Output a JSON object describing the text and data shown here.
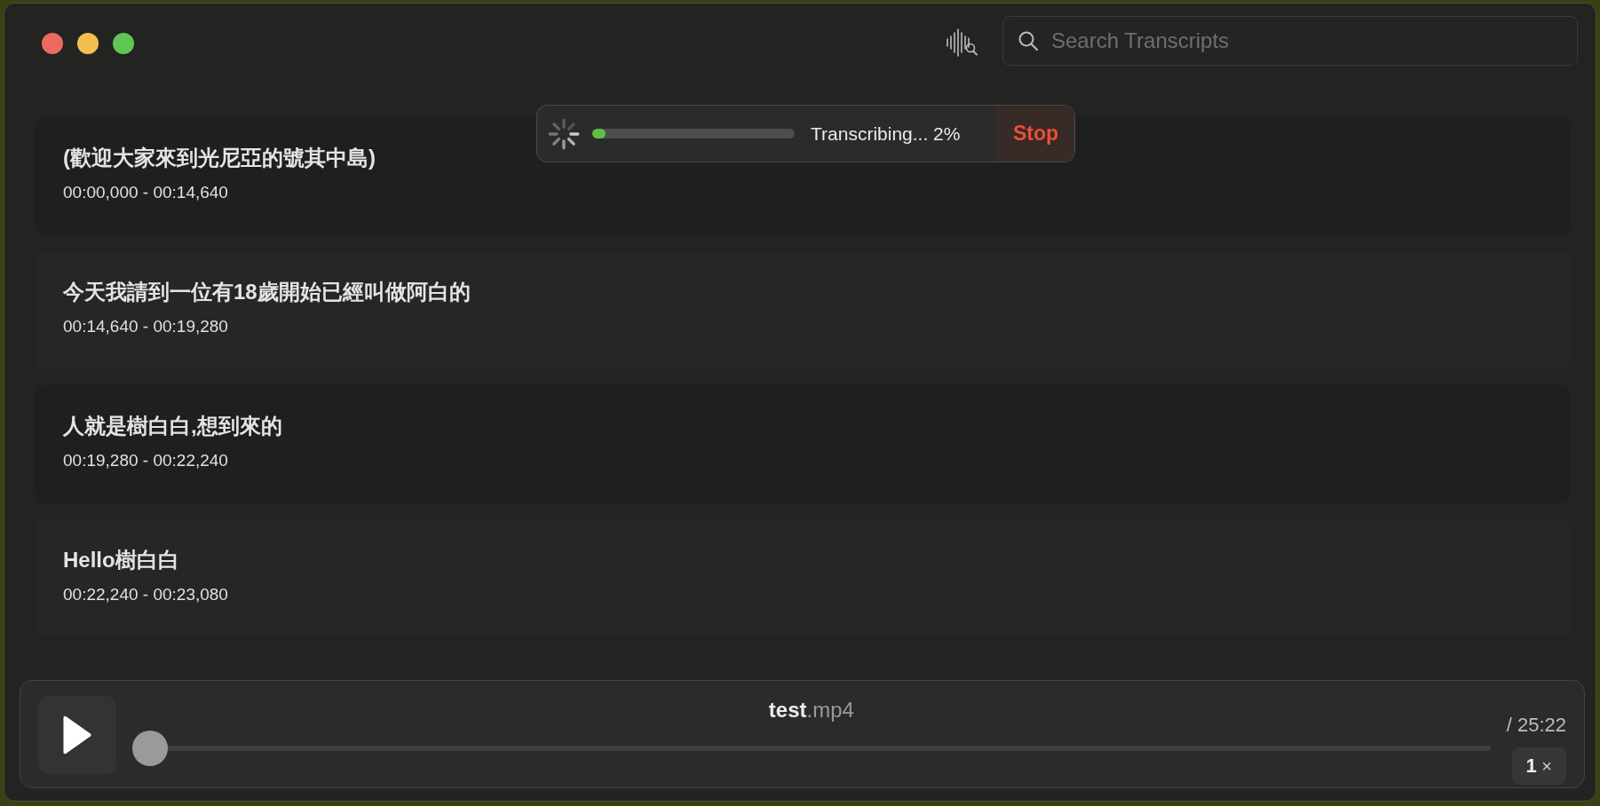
{
  "search": {
    "placeholder": "Search Transcripts"
  },
  "progress": {
    "label": "Transcribing... 2%",
    "level": 0.02,
    "stop": "Stop"
  },
  "transcripts": [
    {
      "text": "(歡迎大家來到光尼亞的號其中島)",
      "time": "00:00,000 - 00:14,640"
    },
    {
      "text": "今天我請到一位有18歲開始已經叫做阿白的",
      "time": "00:14,640 - 00:19,280"
    },
    {
      "text": "人就是樹白白,想到來的",
      "time": "00:19,280 - 00:22,240"
    },
    {
      "text": "Hello樹白白",
      "time": "00:22,240 - 00:23,080"
    }
  ],
  "player": {
    "file_name": "test",
    "file_ext": ".mp4",
    "duration": "/ 25:22",
    "level": 0,
    "speed": "1",
    "speed_unit": "×"
  }
}
